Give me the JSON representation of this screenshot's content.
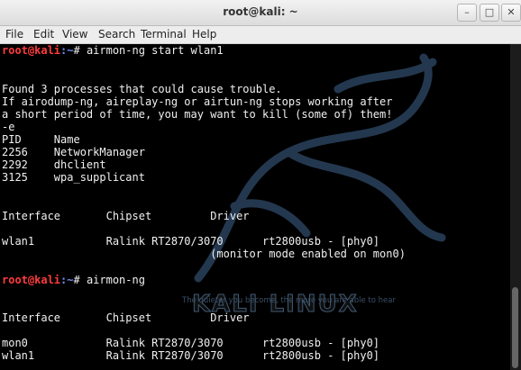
{
  "window": {
    "title": "root@kali: ~",
    "buttons": {
      "minimize": "–",
      "maximize": "□",
      "close": "✕"
    }
  },
  "menu": [
    "File",
    "Edit",
    "View",
    "Search",
    "Terminal",
    "Help"
  ],
  "prompt": {
    "user_host": "root@kali",
    "path": ":~",
    "symbol": "# "
  },
  "terminal": {
    "cmd1": "airmon-ng start wlan1",
    "l_warn1": "Found 3 processes that could cause trouble.",
    "l_warn2": "If airodump-ng, aireplay-ng or airtun-ng stops working after",
    "l_warn3": "a short period of time, you may want to kill (some of) them!",
    "l_e": "-e",
    "l_pidhdr": "PID     Name",
    "l_p1": "2256    NetworkManager",
    "l_p2": "2292    dhclient",
    "l_p3": "3125    wpa_supplicant",
    "l_ifhdr1": "Interface       Chipset         Driver",
    "l_wlan1": "wlan1           Ralink RT2870/3070      rt2800usb - [phy0]",
    "l_monitor": "                                (monitor mode enabled on mon0)",
    "cmd2": "airmon-ng",
    "l_ifhdr2": "Interface       Chipset         Driver",
    "l_mon0": "mon0            Ralink RT2870/3070      rt2800usb - [phy0]",
    "l_wlan1b": "wlan1           Ralink RT2870/3070      rt2800usb - [phy0]"
  },
  "background": {
    "brand": "KALI LINUX",
    "tagline": "The quieter you become, the more you are able to hear"
  },
  "colors": {
    "prompt_user": "#ff3b3b",
    "prompt_path": "#6f8ff5",
    "text": "#f0f0f0",
    "background": "#000000"
  }
}
